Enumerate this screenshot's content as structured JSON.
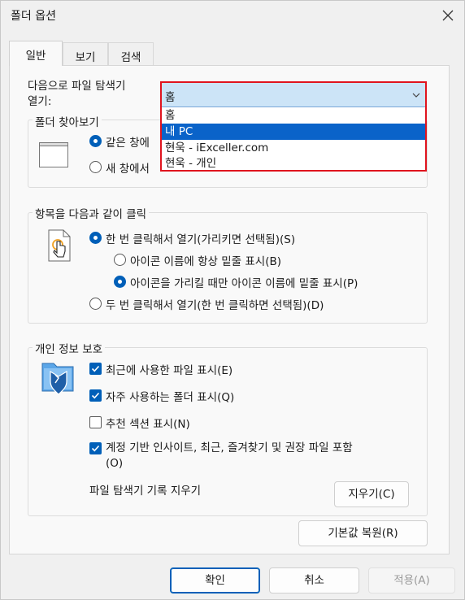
{
  "window": {
    "title": "폴더 옵션"
  },
  "tabs": [
    {
      "label": "일반"
    },
    {
      "label": "보기"
    },
    {
      "label": "검색"
    }
  ],
  "explorer_open": {
    "label": "다음으로 파일 탐색기\n열기:",
    "selected": "홈",
    "options": [
      "홈",
      "내 PC",
      "현욱 - iExceller.com",
      "현욱 - 개인"
    ],
    "highlighted_index": 1
  },
  "browse_folders": {
    "title": "폴더 찾아보기",
    "same_window": "같은 창에",
    "new_window": "새 창에서"
  },
  "click_items": {
    "title": "항목을 다음과 같이 클릭",
    "single_click": "한 번 클릭해서 열기(가리키면 선택됨)(S)",
    "underline_always": "아이콘 이름에 항상 밑줄 표시(B)",
    "underline_hover": "아이콘을 가리킬 때만 아이콘 이름에 밑줄 표시(P)",
    "double_click": "두 번 클릭해서 열기(한 번 클릭하면 선택됨)(D)"
  },
  "privacy": {
    "title": "개인 정보 보호",
    "recent_files": "최근에 사용한 파일 표시(E)",
    "frequent_folders": "자주 사용하는 폴더 표시(Q)",
    "recommended": "추천 섹션 표시(N)",
    "account_insights": "계정 기반 인사이트, 최근, 즐겨찾기 및 권장 파일 포함\n(O)",
    "clear_history_label": "파일 탐색기 기록 지우기",
    "clear_button": "지우기(C)"
  },
  "restore_defaults": "기본값 복원(R)",
  "footer": {
    "ok": "확인",
    "cancel": "취소",
    "apply": "적용(A)"
  },
  "colors": {
    "accent": "#005fb8",
    "highlight_box": "#e0141e",
    "selection": "#0a63c9"
  }
}
